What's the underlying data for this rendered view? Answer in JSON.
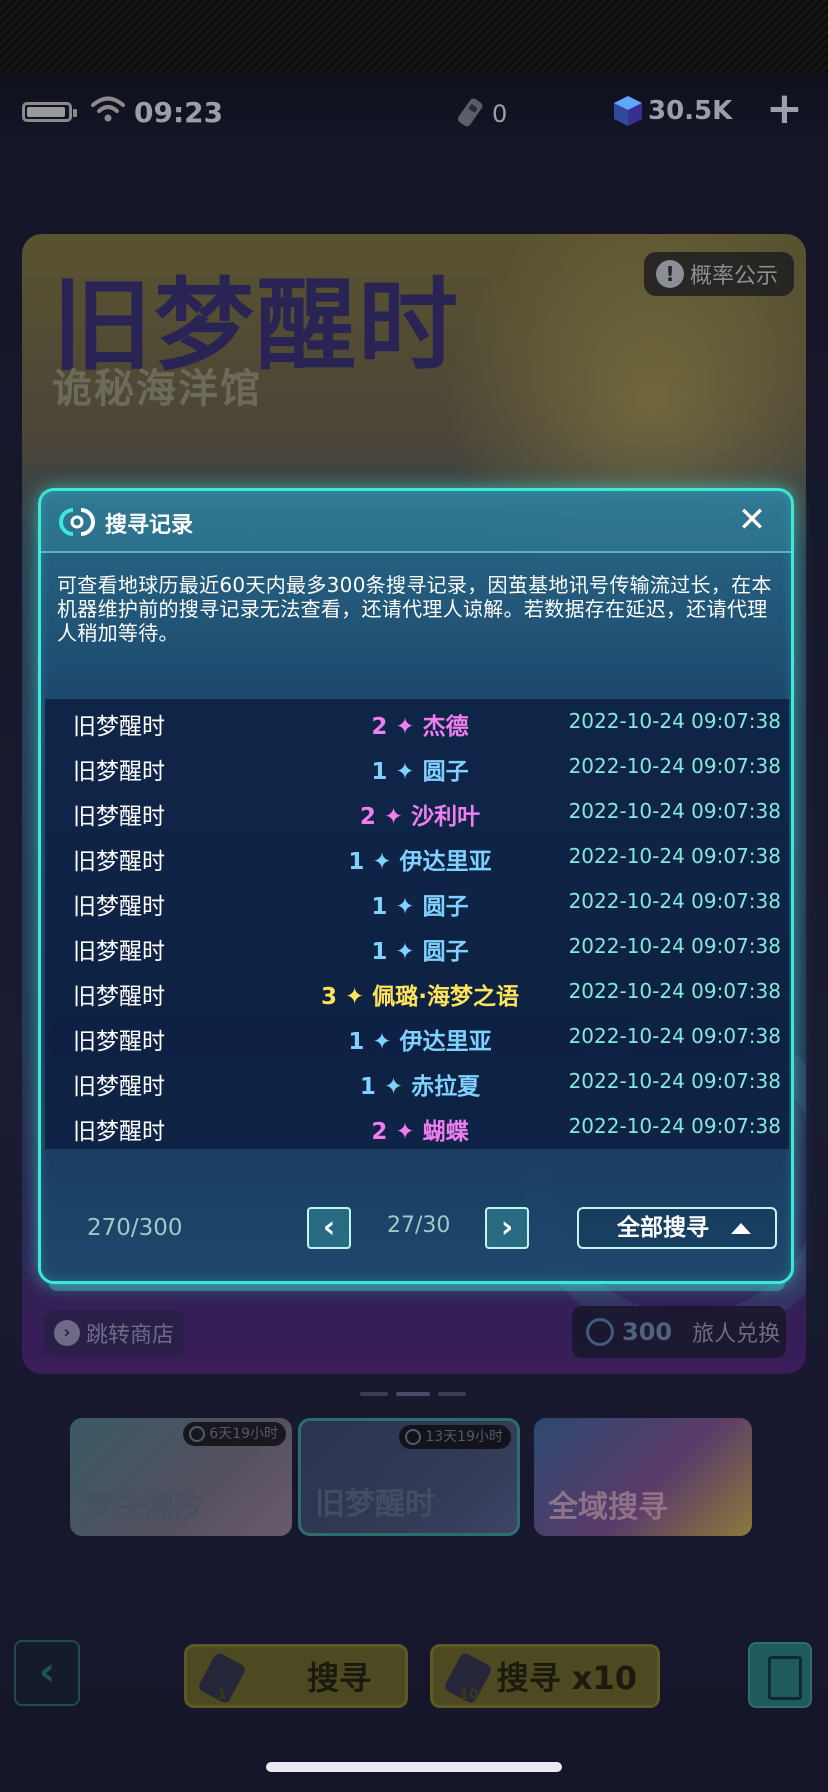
{
  "status_bar": {
    "time": "09:23",
    "keys": "0",
    "crystals": "30.5K"
  },
  "banner": {
    "title": "旧梦醒时",
    "subtitle": "诡秘海洋馆",
    "probability_label": "概率公示",
    "shop_label": "跳转商店",
    "exchange_amount": "300",
    "exchange_label": "旅人兑换"
  },
  "cards": [
    {
      "label": "梦生潮汐",
      "timer": "6天19小时"
    },
    {
      "label": "旧梦醒时",
      "timer": "13天19小时"
    },
    {
      "label": "全域搜寻",
      "timer": ""
    }
  ],
  "bottom_bar": {
    "search_one": "搜寻",
    "search_ten": "搜寻 x10",
    "ticket_one": "1",
    "ticket_ten": "10"
  },
  "modal": {
    "title": "搜寻记录",
    "notice": "可查看地球历最近60天内最多300条搜寻记录，因茧基地讯号传输流过长，在本机器维护前的搜寻记录无法查看，还请代理人谅解。若数据存在延迟，还请代理人稍加等待。",
    "records": [
      {
        "banner": "旧梦醒时",
        "item": "2 ✦ 杰德",
        "time": "2022-10-24 09:07:38",
        "star": 2
      },
      {
        "banner": "旧梦醒时",
        "item": "1 ✦ 圆子",
        "time": "2022-10-24 09:07:38",
        "star": 1
      },
      {
        "banner": "旧梦醒时",
        "item": "2 ✦ 沙利叶",
        "time": "2022-10-24 09:07:38",
        "star": 2
      },
      {
        "banner": "旧梦醒时",
        "item": "1 ✦ 伊达里亚",
        "time": "2022-10-24 09:07:38",
        "star": 1
      },
      {
        "banner": "旧梦醒时",
        "item": "1 ✦ 圆子",
        "time": "2022-10-24 09:07:38",
        "star": 1
      },
      {
        "banner": "旧梦醒时",
        "item": "1 ✦ 圆子",
        "time": "2022-10-24 09:07:38",
        "star": 1
      },
      {
        "banner": "旧梦醒时",
        "item": "3 ✦ 佩璐·海梦之语",
        "time": "2022-10-24 09:07:38",
        "star": 3
      },
      {
        "banner": "旧梦醒时",
        "item": "1 ✦ 伊达里亚",
        "time": "2022-10-24 09:07:38",
        "star": 1
      },
      {
        "banner": "旧梦醒时",
        "item": "1 ✦ 赤拉夏",
        "time": "2022-10-24 09:07:38",
        "star": 1
      },
      {
        "banner": "旧梦醒时",
        "item": "2 ✦ 蝴蝶",
        "time": "2022-10-24 09:07:38",
        "star": 2
      }
    ],
    "record_count": "270/300",
    "page": "27/30",
    "prev_label": "‹",
    "next_label": "›",
    "filter_label": "全部搜寻"
  },
  "colors": {
    "star1": "#7fd2ff",
    "star2": "#ef7ef0",
    "star3": "#ffe35a",
    "accent": "#3ce8d6"
  }
}
